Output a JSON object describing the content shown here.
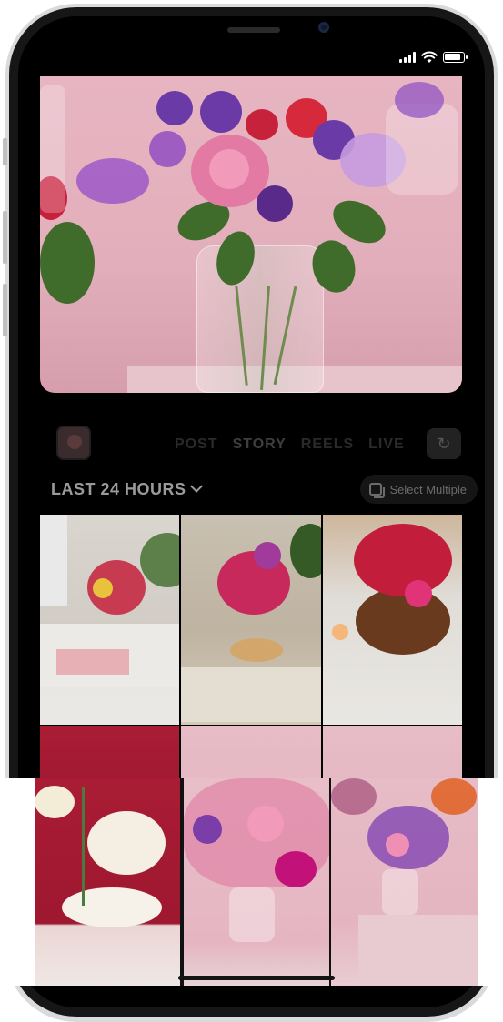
{
  "status_bar": {
    "signal_bars": 4,
    "wifi": "wifi-icon",
    "battery": "battery-icon"
  },
  "camera_modes": {
    "items": [
      "POST",
      "STORY",
      "REELS",
      "LIVE"
    ],
    "active": "STORY"
  },
  "recents": {
    "label": "LAST 24 HOURS",
    "select_multiple": "Select Multiple"
  },
  "colors": {
    "accent_pink": "#e2aebb",
    "red_backdrop": "#a91c34",
    "ui_gray": "#9a9a9a"
  },
  "grid": {
    "items": [
      {
        "name": "photo-bouquet-table-living-room"
      },
      {
        "name": "photo-bouquet-on-wood-stand"
      },
      {
        "name": "photo-red-roses-top-view"
      },
      {
        "name": "photo-white-lisianthus-red-background"
      },
      {
        "name": "photo-pink-lilies-bouquet"
      },
      {
        "name": "photo-two-vases-pink-wall"
      }
    ]
  }
}
